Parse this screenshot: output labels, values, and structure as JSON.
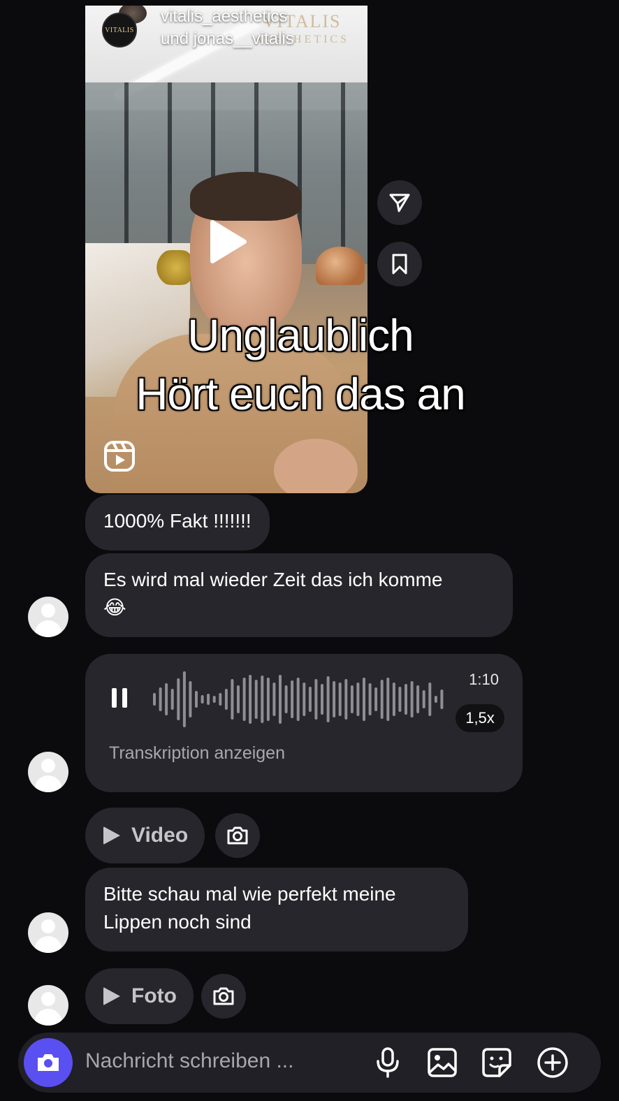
{
  "reel": {
    "author_line1": "vitalis_aesthetics",
    "author_line2": "und jonas__vitalis",
    "brand_watermark": "VITALIS",
    "brand_watermark_sub": "AESTHETICS",
    "avatar_text": "VITALIS"
  },
  "overlay_caption": {
    "line1": "Unglaublich",
    "line2": "Hört euch das an"
  },
  "messages": {
    "m1": "1000% Fakt !!!!!!!",
    "m2_line1": "Es wird mal wieder Zeit das ich komme",
    "m2_emoji": "😂",
    "voice": {
      "duration": "1:10",
      "speed": "1,5x",
      "transcribe_label": "Transkription anzeigen"
    },
    "video_label": "Video",
    "m3_line1": "Bitte schau mal wie perfekt meine",
    "m3_line2": "Lippen noch sind",
    "photo_label": "Foto"
  },
  "composer": {
    "placeholder": "Nachricht schreiben ..."
  },
  "icons": {
    "share": "paper-plane-icon",
    "save": "bookmark-icon",
    "play": "play-icon",
    "reels": "reels-icon",
    "pause": "pause-icon",
    "camera": "camera-icon",
    "mic": "microphone-icon",
    "gallery": "image-icon",
    "sticker": "sticker-icon",
    "plus": "plus-circle-icon"
  },
  "colors": {
    "background": "#0b0b0e",
    "bubble": "#26262c",
    "accent": "#5a4ff0"
  }
}
